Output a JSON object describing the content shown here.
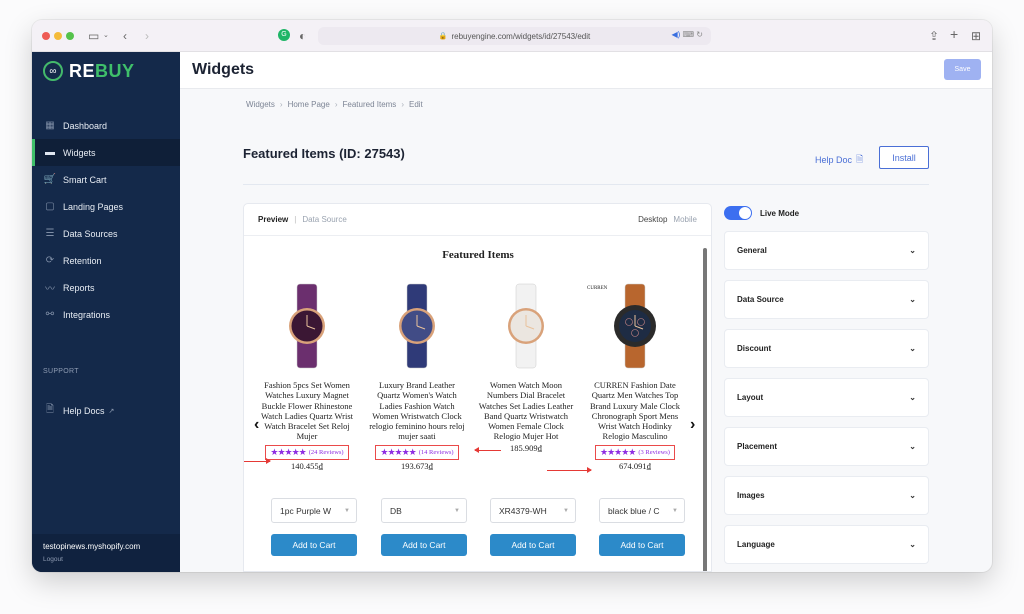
{
  "browser": {
    "url": "rebuyengine.com/widgets/id/27543/edit"
  },
  "sidebar": {
    "logo_re": "RE",
    "logo_buy": "BUY",
    "items": [
      {
        "label": "Dashboard",
        "icon": "grid-icon",
        "glyph": "▦",
        "active": false
      },
      {
        "label": "Widgets",
        "icon": "widget-icon",
        "glyph": "▬",
        "active": true
      },
      {
        "label": "Smart Cart",
        "icon": "cart-icon",
        "glyph": "🛒",
        "active": false
      },
      {
        "label": "Landing Pages",
        "icon": "page-icon",
        "glyph": "▢",
        "active": false
      },
      {
        "label": "Data Sources",
        "icon": "list-icon",
        "glyph": "☰",
        "active": false
      },
      {
        "label": "Retention",
        "icon": "refresh-icon",
        "glyph": "⟳",
        "active": false
      },
      {
        "label": "Reports",
        "icon": "chart-line-icon",
        "glyph": "〰",
        "active": false
      },
      {
        "label": "Integrations",
        "icon": "integrations-icon",
        "glyph": "⚯",
        "active": false
      }
    ],
    "support_heading": "SUPPORT",
    "help_docs": "Help Docs",
    "shop_domain": "testopinews.myshopify.com",
    "logout": "Logout"
  },
  "header": {
    "title": "Widgets",
    "save": "Save"
  },
  "breadcrumb": [
    "Widgets",
    "Home Page",
    "Featured Items",
    "Edit"
  ],
  "widget": {
    "title": "Featured Items (ID: 27543)",
    "help_doc": "Help Doc",
    "install": "Install"
  },
  "preview": {
    "tab_preview": "Preview",
    "tab_data_source": "Data Source",
    "device_desktop": "Desktop",
    "device_mobile": "Mobile",
    "heading": "Featured Items",
    "products": [
      {
        "name": "Fashion 5pcs Set Women Watches Luxury Magnet Buckle Flower Rhinestone Watch Ladies Quartz Wrist Watch Bracelet Set Reloj Mujer",
        "stars": "★★★★★",
        "reviews": "(24 Reviews)",
        "price": "140.455₫",
        "variant": "1pc Purple W",
        "add_to_cart": "Add to Cart"
      },
      {
        "name": "Luxury Brand Leather Quartz Women's Watch Ladies Fashion Watch Women Wristwatch Clock relogio feminino hours reloj mujer saati",
        "stars": "★★★★★",
        "reviews": "(14 Reviews)",
        "price": "193.673₫",
        "variant": "DB",
        "add_to_cart": "Add to Cart"
      },
      {
        "name": "Women Watch Moon Numbers Dial Bracelet Watches Set Ladies Leather Band Quartz Wristwatch Women Female Clock Relogio Mujer Hot",
        "stars": "",
        "reviews": "",
        "price": "185.909₫",
        "variant": "XR4379-WH",
        "add_to_cart": "Add to Cart"
      },
      {
        "name": "CURREN Fashion Date Quartz Men Watches Top Brand Luxury Male Clock Chronograph Sport Mens Wrist Watch Hodinky Relogio Masculino",
        "stars": "★★★★★",
        "reviews": "(3 Reviews)",
        "price": "674.091₫",
        "variant": "black blue / C",
        "add_to_cart": "Add to Cart",
        "brand_tag": "CURREN"
      }
    ]
  },
  "settings": {
    "live_mode": "Live Mode",
    "live_mode_on": true,
    "sections": [
      "General",
      "Data Source",
      "Discount",
      "Layout",
      "Placement",
      "Images",
      "Language"
    ]
  },
  "colors": {
    "sidebar_bg": "#14294a",
    "brand_green": "#3fbf6a",
    "accent_blue": "#4a6fd6",
    "add_to_cart": "#2c8ac9",
    "star_purple": "#8e2de2",
    "annotation_red": "#e53935"
  }
}
